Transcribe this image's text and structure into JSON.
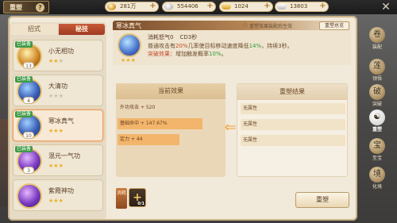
{
  "header": {
    "title": "重塑",
    "help": "?",
    "currencies": [
      {
        "value": "281万",
        "icon": "gold-coin-icon"
      },
      {
        "value": "554406",
        "icon": "silver-coin-icon"
      },
      {
        "value": "1024",
        "icon": "gold-ingot-icon"
      },
      {
        "value": "13803",
        "icon": "silver-ingot-icon"
      }
    ],
    "plus": "+",
    "close": "✕"
  },
  "tabs": [
    {
      "label": "招式",
      "active": false
    },
    {
      "label": "秘技",
      "active": true
    }
  ],
  "skills": [
    {
      "name": "小无相功",
      "level": "13",
      "equipped": "已装备",
      "stars": 2,
      "max_stars": 3
    },
    {
      "name": "大清功",
      "level": "4",
      "equipped": "已装备",
      "stars": 0,
      "max_stars": 3
    },
    {
      "name": "寒冰真气",
      "level": "10",
      "equipped": "已装备",
      "stars": 3,
      "max_stars": 3,
      "selected": true
    },
    {
      "name": "混元一气功",
      "level": "3",
      "equipped": "已装备",
      "stars": 3,
      "max_stars": 3
    },
    {
      "name": "紫霞神功",
      "level": "",
      "equipped": "",
      "stars": 3,
      "max_stars": 3
    }
  ],
  "detail": {
    "title": "寒冰真气",
    "tip": "重塑效果装配后生效",
    "tip_button": "重塑总览",
    "cost": "消耗怒气0",
    "cd": "CD3秒",
    "line1_a": "普通攻击有",
    "line1_b": "20%",
    "line1_c": "几率使目标移动速度降低",
    "line1_d": "14%",
    "line1_e": "，持续3秒。",
    "line2_a": "突破效果：",
    "line2_b": "增加触发概率",
    "line2_c": "10%",
    "line2_d": "。",
    "stars": 3
  },
  "current_effects": {
    "header": "当前效果",
    "rows": [
      {
        "text": "外功攻击 + 520",
        "fill": 0.0
      },
      {
        "text": "基础命中 + 147.67%",
        "fill": 0.8
      },
      {
        "text": "定力 + 44",
        "fill": 0.58
      }
    ]
  },
  "reshape_results": {
    "header": "重塑结果",
    "rows": [
      "无属性",
      "无属性",
      "无属性"
    ]
  },
  "materials": {
    "label": "消耗",
    "slot_plus": "+",
    "count": "0/1"
  },
  "reshape_button": "重塑",
  "sidenav": [
    {
      "label": "装配",
      "icon": "scroll-icon",
      "active": false
    },
    {
      "label": "领悟",
      "icon": "lotus-icon",
      "active": false
    },
    {
      "label": "突破",
      "icon": "breakthrough-icon",
      "active": false
    },
    {
      "label": "重塑",
      "icon": "yin-yang-icon",
      "active": true
    },
    {
      "label": "至宝",
      "icon": "treasure-icon",
      "active": false
    },
    {
      "label": "化境",
      "icon": "mountain-icon",
      "active": false
    }
  ]
}
